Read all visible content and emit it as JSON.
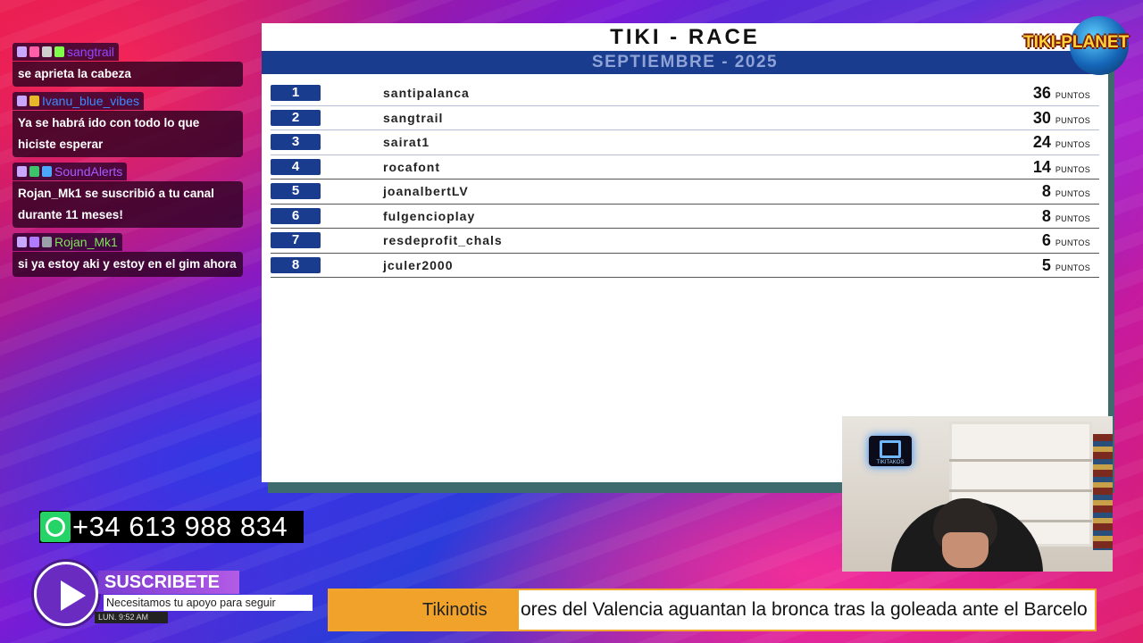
{
  "chat": [
    {
      "user": "sangtrail",
      "user_color": "#9147ff",
      "badges": [
        "#c9a7ff",
        "#ff5fa8",
        "#cfcfcf",
        "#7fff4a"
      ],
      "text": "se aprieta la cabeza"
    },
    {
      "user": "Ivanu_blue_vibes",
      "user_color": "#3b8bff",
      "badges": [
        "#c9a7ff",
        "#e7b82a"
      ],
      "text": "Ya se habrá ido con todo lo que hiciste esperar"
    },
    {
      "user": "SoundAlerts",
      "user_color": "#a55bff",
      "badges": [
        "#c9a7ff",
        "#3cc46a",
        "#4aa8ff"
      ],
      "text": "Rojan_Mk1 se suscribió a tu canal durante 11 meses!"
    },
    {
      "user": "Rojan_Mk1",
      "user_color": "#7fe25a",
      "badges": [
        "#c9a7ff",
        "#b07bff",
        "#9aa0aa"
      ],
      "text": "si ya estoy aki y estoy en el gim ahora"
    }
  ],
  "board": {
    "title": "TIKI - RACE",
    "subtitle": "SEPTIEMBRE - 2025",
    "points_label": "PUNTOS",
    "rows": [
      {
        "rank": "1",
        "name": "santipalanca",
        "points": "36"
      },
      {
        "rank": "2",
        "name": "sangtrail",
        "points": "30"
      },
      {
        "rank": "3",
        "name": "sairat1",
        "points": "24"
      },
      {
        "rank": "4",
        "name": "rocafont",
        "points": "14"
      },
      {
        "rank": "5",
        "name": "joanalbertLV",
        "points": "8"
      },
      {
        "rank": "6",
        "name": "fulgencioplay",
        "points": "8"
      },
      {
        "rank": "7",
        "name": "resdeprofit_chals",
        "points": "6"
      },
      {
        "rank": "8",
        "name": "jculer2000",
        "points": "5"
      }
    ]
  },
  "logo": {
    "text": "TIKI-PLANET"
  },
  "webcam": {
    "sign": "TIKITAKOS"
  },
  "phone": {
    "number": "+34 613 988 834",
    "icon": "whatsapp-icon"
  },
  "subscribe": {
    "title": "SUSCRIBETE",
    "description": "Necesitamos tu apoyo para seguir",
    "time": "LUN. 9:52 AM"
  },
  "ticker": {
    "label": "Tikinotis",
    "text": "ores del Valencia aguantan la bronca tras la goleada ante el Barcelo"
  },
  "colors": {
    "board_blue": "#1a3c8f",
    "ticker_orange": "#f0a22a",
    "whatsapp_green": "#25d366"
  }
}
